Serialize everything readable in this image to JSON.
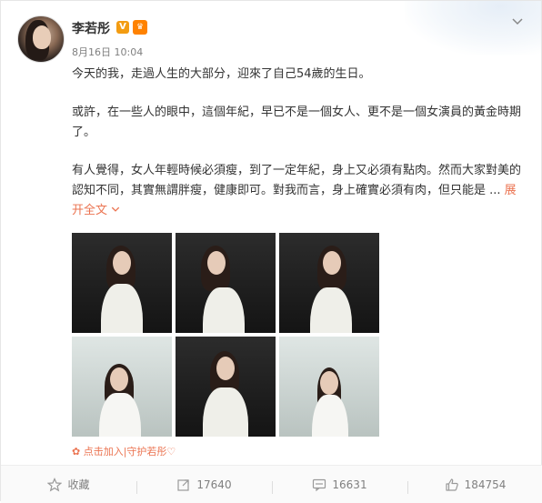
{
  "post": {
    "author": "李若彤",
    "verified_badge": "V",
    "vip_badge": "♛",
    "time": "8月16日 10:04",
    "paragraphs": [
      "今天的我，走過人生的大部分，迎來了自己54歲的生日。",
      "或許，在一些人的眼中，這個年紀，早已不是一個女人、更不是一個女演員的黃金時期了。",
      "有人覺得，女人年輕時候必須瘦，到了一定年紀，身上又必須有點肉。然而大家對美的認知不同，其實無謂胖瘦，健康即可。對我而言，身上確實必須有肉，但只能是 ..."
    ],
    "expand_label": "展开全文",
    "source_label": "点击加入|守护若彤♡"
  },
  "photos": [
    {
      "bg": "dark"
    },
    {
      "bg": "dark"
    },
    {
      "bg": "dark"
    },
    {
      "bg": "light"
    },
    {
      "bg": "dark"
    },
    {
      "bg": "light"
    }
  ],
  "actions": {
    "favorite_label": "收藏",
    "repost_count": "17640",
    "comment_count": "16631",
    "like_count": "184754"
  },
  "colors": {
    "accent": "#eb7350",
    "text": "#333333",
    "muted": "#808080"
  }
}
